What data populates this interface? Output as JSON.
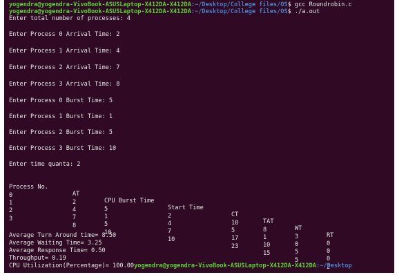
{
  "terminal": {
    "prompt_user": "yogendra@yogendra-VivoBook-ASUSLaptop-X412DA-X412DA",
    "prompt_path": ":~/Desktop/College files/OS",
    "prompt_path_last": ":~/Desktop",
    "cmd1": "$ gcc Roundrobin.c",
    "cmd2": "$ ./a.out",
    "inputs": [
      "Enter total number of processes: 4",
      "Enter Process 0 Arrival Time: 2",
      "Enter Process 1 Arrival Time: 4",
      "Enter Process 2 Arrival Time: 7",
      "Enter Process 3 Arrival Time: 8",
      "Enter Process 0 Burst Time: 5",
      "Enter Process 1 Burst Time: 1",
      "Enter Process 2 Burst Time: 5",
      "Enter Process 3 Burst Time: 10",
      "Enter time quanta: 2"
    ],
    "table": {
      "headers": [
        "Process No.",
        "AT",
        "CPU Burst Time",
        "Start Time",
        "CT",
        "TAT",
        "WT",
        "RT"
      ],
      "rows": [
        [
          "0",
          "2",
          "5",
          "2",
          "10",
          "8",
          "3",
          "0"
        ],
        [
          "1",
          "4",
          "1",
          "4",
          "5",
          "1",
          "0",
          "0"
        ],
        [
          "2",
          "7",
          "5",
          "7",
          "17",
          "10",
          "5",
          "0"
        ],
        [
          "3",
          "8",
          "10",
          "10",
          "23",
          "15",
          "5",
          "2"
        ]
      ]
    },
    "summary": [
      "Average Turn Around time= 8.50",
      "Average Waiting Time= 3.25",
      "Average Response Time= 0.50",
      "Throughput= 0.19"
    ],
    "last_line": "CPU Utilization(Percentage)= 100.00"
  }
}
